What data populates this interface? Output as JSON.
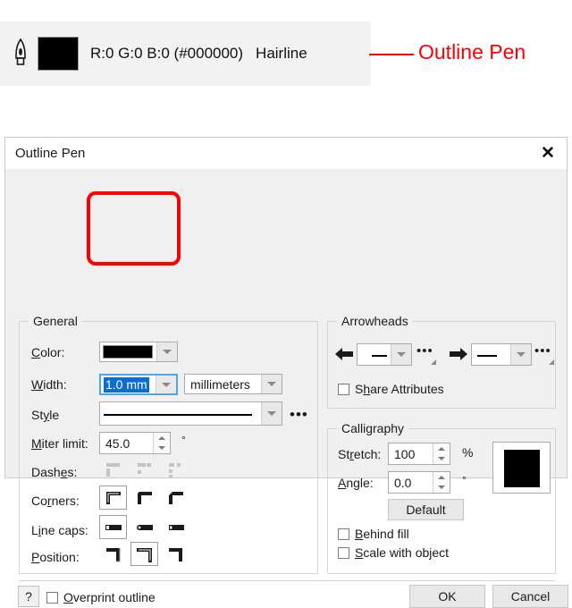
{
  "status_banner": {
    "nib_icon": "pen-nib-icon",
    "swatch_color": "#000000",
    "rgb_text": "R:0 G:0 B:0 (#000000)",
    "width_text": "Hairline"
  },
  "annotation": {
    "label": "Outline Pen",
    "color": "#ff0000"
  },
  "dialog": {
    "title": "Outline Pen",
    "close_label": "✕",
    "general": {
      "legend": "General",
      "color": {
        "label": "Color:",
        "swatch": "#000000"
      },
      "width": {
        "label": "Width:",
        "value": "1.0 mm",
        "units_value": "millimeters"
      },
      "style": {
        "label": "Style",
        "ellipsis": "•••"
      },
      "miter_limit": {
        "label": "Miter limit:",
        "value": "45.0",
        "unit": "°"
      },
      "dashes": {
        "label": "Dashes:"
      },
      "corners": {
        "label": "Corners:",
        "selected_index": 0
      },
      "line_caps": {
        "label": "Line caps:",
        "selected_index": 0
      },
      "position": {
        "label": "Position:",
        "selected_index": 1
      }
    },
    "arrowheads": {
      "legend": "Arrowheads",
      "start_value": "",
      "end_value": "",
      "start_flyout": "•••",
      "end_flyout": "•••",
      "share_attributes": {
        "label": "Share Attributes",
        "checked": false
      }
    },
    "calligraphy": {
      "legend": "Calligraphy",
      "stretch": {
        "label": "Stretch:",
        "value": "100",
        "unit": "%"
      },
      "angle": {
        "label": "Angle:",
        "value": "0.0",
        "unit": "°"
      },
      "default_button": "Default",
      "behind_fill": {
        "label": "Behind fill",
        "checked": false
      },
      "scale_with_object": {
        "label": "Scale with object",
        "checked": false
      },
      "nib_preview_color": "#000000"
    },
    "footer": {
      "help_label": "?",
      "overprint": {
        "label": "Overprint outline",
        "checked": false
      },
      "ok_label": "OK",
      "cancel_label": "Cancel"
    }
  }
}
